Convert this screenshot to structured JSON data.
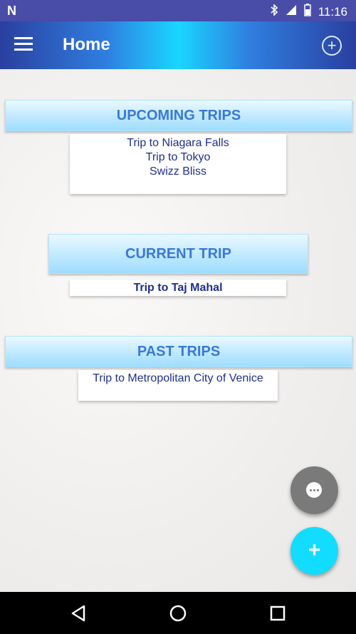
{
  "status_bar": {
    "time": "11:16"
  },
  "app_bar": {
    "title": "Home"
  },
  "sections": {
    "upcoming": {
      "title": "UPCOMING TRIPS",
      "items": [
        "Trip to Niagara Falls",
        "Trip to Tokyo",
        "Swizz Bliss"
      ]
    },
    "current": {
      "title": "CURRENT TRIP",
      "items": [
        "Trip to Taj Mahal"
      ]
    },
    "past": {
      "title": "PAST TRIPS",
      "items": [
        "Trip to Metropolitan City of Venice"
      ]
    }
  },
  "fab": {
    "add_symbol": "+"
  },
  "icons": {
    "menu": "menu-icon",
    "add_circle": "add-circle-icon",
    "more": "more-horiz-icon",
    "add": "add-icon",
    "back": "back-icon",
    "home": "home-icon",
    "recents": "recents-icon"
  },
  "colors": {
    "status_bar": "#4a4da8",
    "header_text": "#3a78d8",
    "list_text": "#1e2f8c",
    "fab_primary": "#12dcff",
    "fab_secondary": "#7a7a7a"
  }
}
